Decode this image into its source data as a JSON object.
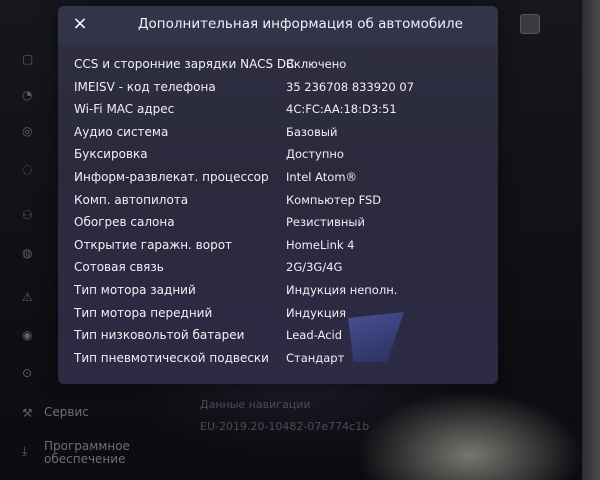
{
  "modal": {
    "title": "Дополнительная информация об автомобиле",
    "close_icon": "×",
    "rows": [
      {
        "label": "CCS и сторонние зарядки NACS DC",
        "value": "Включено"
      },
      {
        "label": "IMEISV - код телефона",
        "value": "35 236708 833920 07"
      },
      {
        "label": "Wi-Fi MAC адрес",
        "value": "4C:FC:AA:18:D3:51"
      },
      {
        "label": "Аудио система",
        "value": "Базовый"
      },
      {
        "label": "Буксировка",
        "value": "Доступно"
      },
      {
        "label": "Информ-развлекат. процессор",
        "value": "Intel Atom®"
      },
      {
        "label": "Комп. автопилота",
        "value": "Компьютер FSD"
      },
      {
        "label": "Обогрев салона",
        "value": "Резистивный"
      },
      {
        "label": "Открытие гаражн. ворот",
        "value": "HomeLink 4"
      },
      {
        "label": "Сотовая связь",
        "value": "2G/3G/4G"
      },
      {
        "label": "Тип мотора задний",
        "value": "Индукция неполн."
      },
      {
        "label": "Тип мотора передний",
        "value": "Индукция"
      },
      {
        "label": "Тип низковольтой батареи",
        "value": "Lead-Acid"
      },
      {
        "label": "Тип пневмотической подвески",
        "value": "Стандарт"
      }
    ]
  },
  "background": {
    "sidebar_items": [
      "Сервис",
      "Программное",
      "обеспечение"
    ],
    "texts": [
      "Данные навигации",
      "EU-2019.20-10482-07e774c1b"
    ]
  }
}
